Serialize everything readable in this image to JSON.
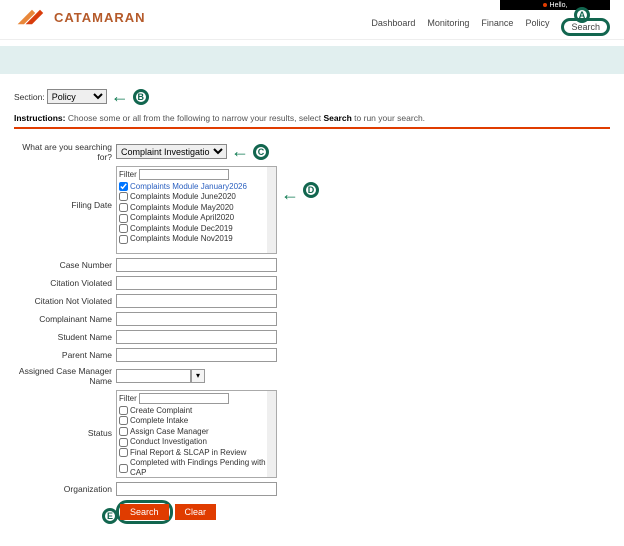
{
  "brand": {
    "name": "CATAMARAN"
  },
  "helloBar": {
    "text": "Hello,"
  },
  "nav": {
    "items": [
      "Dashboard",
      "Monitoring",
      "Finance",
      "Policy",
      "Search"
    ]
  },
  "markers": {
    "A": "A",
    "B": "B",
    "C": "C",
    "D": "D",
    "E": "E"
  },
  "section": {
    "label": "Section:",
    "value": "Policy"
  },
  "instructions": {
    "prefix": "Instructions:",
    "text": " Choose some or all from the following to narrow your results, select ",
    "bold": "Search",
    "suffix": " to run your search."
  },
  "searchFor": {
    "label": "What are you searching for?",
    "value": "Complaint Investigation"
  },
  "filingDate": {
    "label": "Filing Date",
    "filterLabel": "Filter",
    "options": [
      {
        "label": "Complaints Module January2026",
        "checked": true,
        "blue": true
      },
      {
        "label": "Complaints Module June2020",
        "checked": false
      },
      {
        "label": "Complaints Module May2020",
        "checked": false
      },
      {
        "label": "Complaints Module April2020",
        "checked": false
      },
      {
        "label": "Complaints Module Dec2019",
        "checked": false
      },
      {
        "label": "Complaints Module Nov2019",
        "checked": false
      }
    ]
  },
  "fields": {
    "caseNumber": "Case Number",
    "citationViolated": "Citation Violated",
    "citationNotViolated": "Citation Not Violated",
    "complainantName": "Complainant Name",
    "studentName": "Student Name",
    "parentName": "Parent Name",
    "assignedManager": "Assigned Case Manager Name",
    "organization": "Organization"
  },
  "status": {
    "label": "Status",
    "filterLabel": "Filter",
    "options": [
      "Create Complaint",
      "Complete Intake",
      "Assign Case Manager",
      "Conduct Investigation",
      "Final Report & SLCAP in Review",
      "Completed with Findings Pending with CAP"
    ]
  },
  "buttons": {
    "search": "Search",
    "clear": "Clear"
  }
}
